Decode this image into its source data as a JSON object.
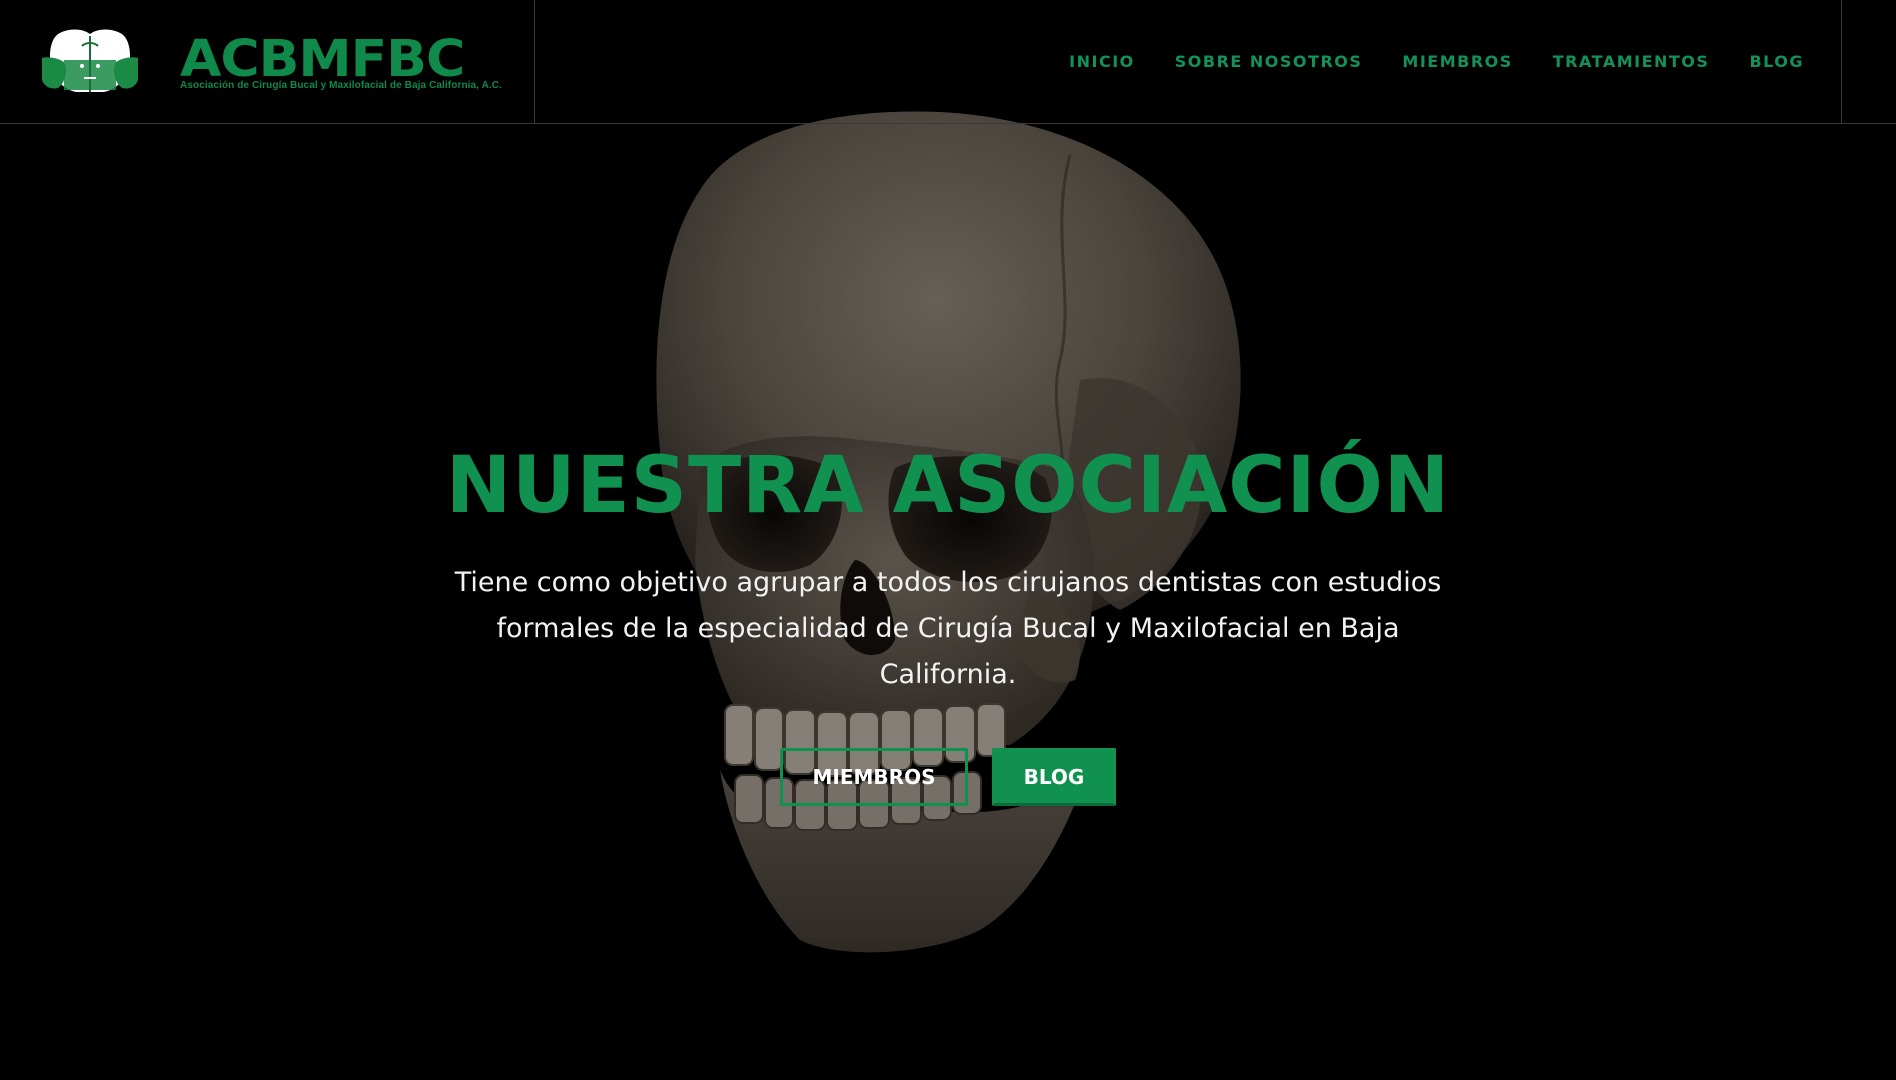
{
  "header": {
    "logo_text": "ACBMFBC",
    "logo_tagline": "Asociación de Cirugía Bucal y Maxilofacial de Baja California, A.C.",
    "nav": [
      {
        "label": "INICIO"
      },
      {
        "label": "SOBRE NOSOTROS"
      },
      {
        "label": "MIEMBROS"
      },
      {
        "label": "TRATAMIENTOS"
      },
      {
        "label": "BLOG"
      }
    ]
  },
  "hero": {
    "background_image": "skull-image",
    "title": "NUESTRA ASOCIACIÓN",
    "text_line1": "Tiene como objetivo agrupar a todos los cirujanos dentistas con estudios",
    "text_line2": "formales de la especialidad de Cirugía Bucal y Maxilofacial en Baja California.",
    "buttons": {
      "primary_outline": "MIEMBROS",
      "primary_solid": "BLOG"
    }
  },
  "colors": {
    "accent": "#11914f",
    "background": "#000000",
    "text": "#f2f2f2"
  }
}
